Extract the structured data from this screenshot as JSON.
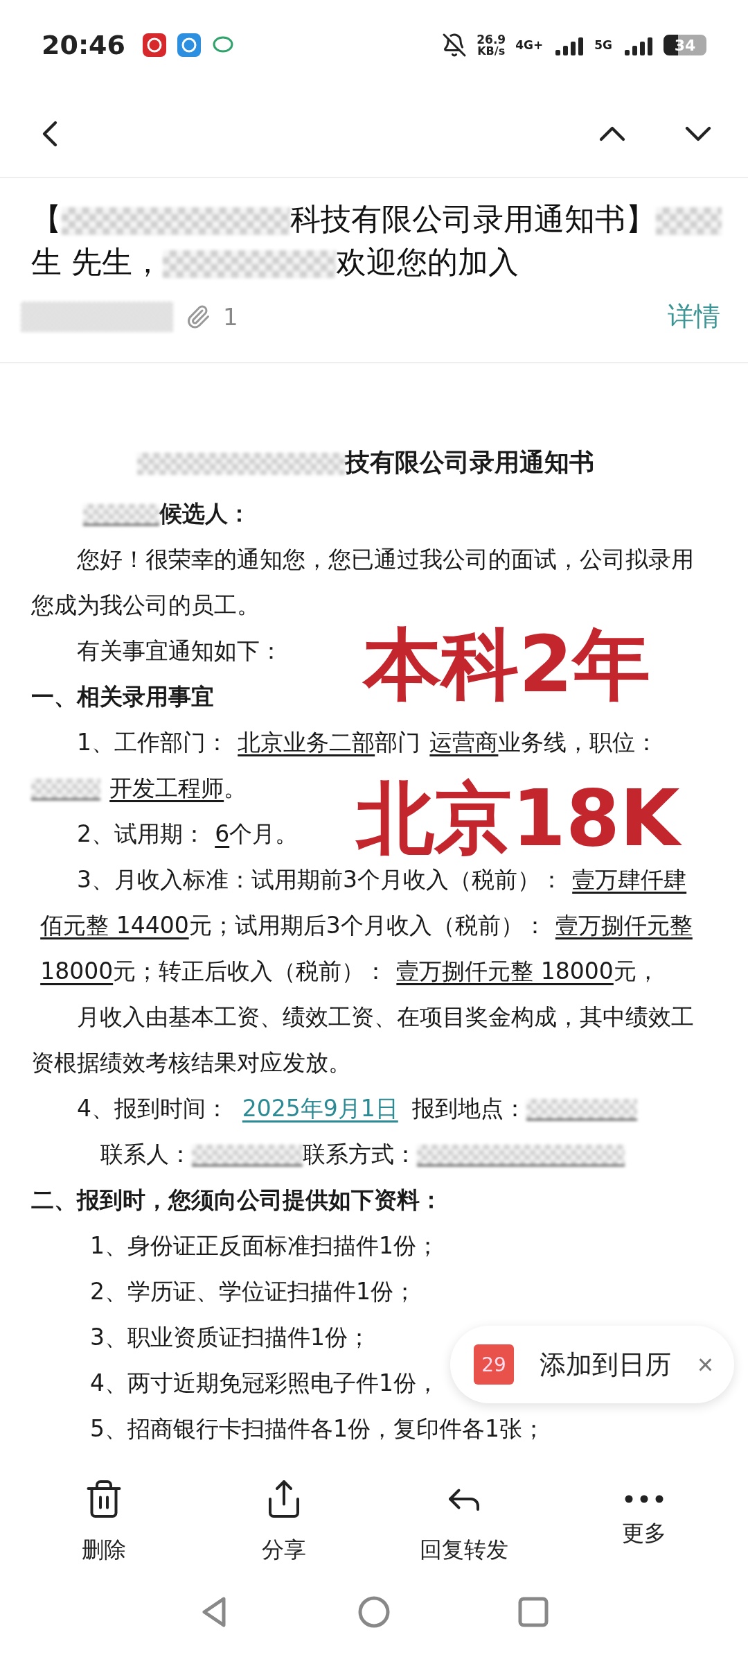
{
  "status_bar": {
    "time": "20:46",
    "speed": "26.9",
    "speed_unit": "KB/s",
    "network_1": "4G+",
    "network_2": "5G",
    "battery": "34"
  },
  "subject": [
    {
      "kind": "text",
      "text": "【"
    },
    {
      "kind": "mask"
    },
    {
      "kind": "text",
      "text": "科技有限公司录用通知书】"
    },
    {
      "kind": "mask"
    },
    {
      "kind": "text",
      "text": "生 先生，"
    },
    {
      "kind": "mask"
    },
    {
      "kind": "text",
      "text": "欢迎您的加入"
    }
  ],
  "meta": {
    "attachment_count": "1",
    "details": "详情"
  },
  "doc": {
    "blocks": [
      {
        "kind": "title",
        "segments": [
          {
            "kind": "mask"
          },
          {
            "kind": "text",
            "text": "技有限公司录用通知书"
          }
        ]
      },
      {
        "kind": "salutation",
        "segments": [
          {
            "kind": "mask",
            "underlined": true
          },
          {
            "kind": "text",
            "text": "候选人："
          }
        ]
      },
      {
        "kind": "para",
        "segments": [
          {
            "kind": "text",
            "text": "您好！很荣幸的通知您，您已通过我公司的面试，公司拟录用您成为我公司的员工。"
          }
        ]
      },
      {
        "kind": "para",
        "segments": [
          {
            "kind": "text",
            "text": "有关事宜通知如下："
          }
        ]
      },
      {
        "kind": "heading",
        "segments": [
          {
            "kind": "text",
            "text": "一、相关录用事宜"
          }
        ]
      },
      {
        "kind": "para",
        "segments": [
          {
            "kind": "text",
            "text": "1、工作部门："
          },
          {
            "kind": "blank",
            "text": "北京业务二部"
          },
          {
            "kind": "text",
            "text": "部门"
          },
          {
            "kind": "blank",
            "text": "运营商"
          },
          {
            "kind": "text",
            "text": "业务线，职位："
          },
          {
            "kind": "mask",
            "underlined": true
          },
          {
            "kind": "blank",
            "text": "开发工程师"
          },
          {
            "kind": "text",
            "text": "。"
          }
        ]
      },
      {
        "kind": "para",
        "segments": [
          {
            "kind": "text",
            "text": "2、试用期："
          },
          {
            "kind": "blank",
            "text": "6"
          },
          {
            "kind": "text",
            "text": "个月。"
          }
        ]
      },
      {
        "kind": "para",
        "segments": [
          {
            "kind": "text",
            "text": "3、月收入标准：试用期前3个月收入（税前）："
          },
          {
            "kind": "blank",
            "text": "壹万肆仟肆"
          },
          {
            "kind": "blank",
            "text": "佰元整 14400"
          },
          {
            "kind": "text",
            "text": "元；试用期后3个月收入（税前）："
          },
          {
            "kind": "blank",
            "text": "壹万捌仟元整"
          },
          {
            "kind": "blank",
            "text": "18000"
          },
          {
            "kind": "text",
            "text": "元；转正后收入（税前）："
          },
          {
            "kind": "blank",
            "text": "壹万捌仟元整 18000"
          },
          {
            "kind": "text",
            "text": "元，"
          }
        ]
      },
      {
        "kind": "para",
        "segments": [
          {
            "kind": "text",
            "text": "月收入由基本工资、绩效工资、在项目奖金构成，其中绩效工资根据绩效考核结果对应发放。"
          }
        ]
      },
      {
        "kind": "para",
        "segments": [
          {
            "kind": "text",
            "text": "4、报到时间："
          },
          {
            "kind": "link",
            "text": "2025年9月1日"
          },
          {
            "kind": "text",
            "text": "报到地点："
          },
          {
            "kind": "mask",
            "underlined": true
          }
        ]
      },
      {
        "kind": "contact",
        "segments": [
          {
            "kind": "text",
            "text": "联系人："
          },
          {
            "kind": "mask",
            "underlined": true
          },
          {
            "kind": "text",
            "text": "联系方式："
          },
          {
            "kind": "mask",
            "underlined": true
          }
        ]
      },
      {
        "kind": "heading",
        "segments": [
          {
            "kind": "text",
            "text": "二、报到时，您须向公司提供如下资料："
          }
        ]
      },
      {
        "kind": "item",
        "segments": [
          {
            "kind": "text",
            "text": "1、身份证正反面标准扫描件1份；"
          }
        ]
      },
      {
        "kind": "item",
        "segments": [
          {
            "kind": "text",
            "text": "2、学历证、学位证扫描件1份；"
          }
        ]
      },
      {
        "kind": "item",
        "segments": [
          {
            "kind": "text",
            "text": "3、职业资质证扫描件1份；"
          }
        ]
      },
      {
        "kind": "item",
        "segments": [
          {
            "kind": "text",
            "text": "4、两寸近期免冠彩照电子件1份，"
          }
        ]
      },
      {
        "kind": "item",
        "segments": [
          {
            "kind": "text",
            "text": "5、招商银行卡扫描件各1份，复印件各1张；"
          }
        ]
      }
    ],
    "stamps": [
      {
        "text": "本科2年"
      },
      {
        "text": "北京18K"
      }
    ]
  },
  "calendar_popup": {
    "day": "29",
    "label": "添加到日历",
    "close": "×"
  },
  "toolbar": [
    {
      "kind": "delete",
      "label": "删除"
    },
    {
      "kind": "share",
      "label": "分享"
    },
    {
      "kind": "reply",
      "label": "回复转发"
    },
    {
      "kind": "more",
      "label": "更多"
    }
  ]
}
